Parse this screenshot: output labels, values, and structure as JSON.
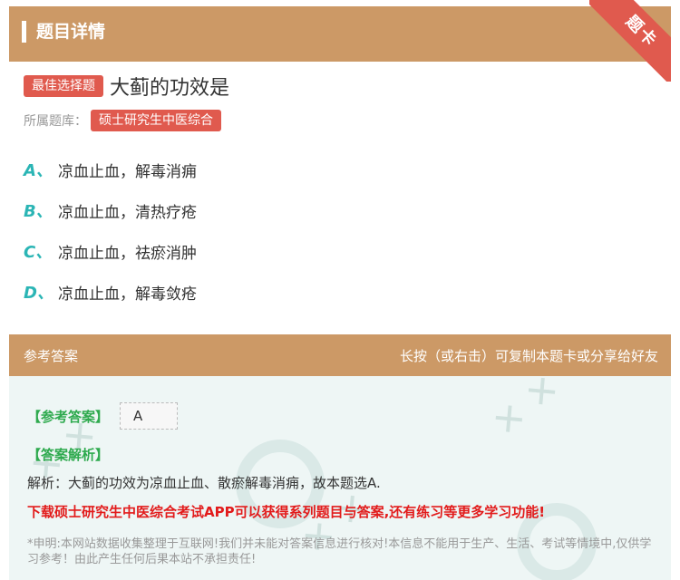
{
  "header": {
    "title": "题目详情",
    "ribbon_label": "题卡"
  },
  "question": {
    "type_badge": "最佳选择题",
    "title": "大蓟的功效是",
    "library_label": "所属题库：",
    "library_name": "硕士研究生中医综合"
  },
  "options": [
    {
      "letter": "A、",
      "text": "凉血止血，解毒消痈"
    },
    {
      "letter": "B、",
      "text": "凉血止血，清热疗疮"
    },
    {
      "letter": "C、",
      "text": "凉血止血，祛瘀消肿"
    },
    {
      "letter": "D、",
      "text": "凉血止血，解毒敛疮"
    }
  ],
  "answer": {
    "section_label": "参考答案",
    "share_hint": "长按（或右击）可复制本题卡或分享给好友",
    "ref_label": "【参考答案】",
    "ref_value": "A",
    "explain_label": "【答案解析】",
    "explain_text": "解析：大蓟的功效为凉血止血、散瘀解毒消痈，故本题选A.",
    "promo_text": "下载硕士研究生中医综合考试APP可以获得系列题目与答案,还有练习等更多学习功能!",
    "disclaimer": "*申明:本网站数据收集整理于互联网!我们并未能对答案信息进行核对!本信息不能用于生产、生活、考试等情境中,仅供学习参考！由此产生任何后果本站不承担责任!"
  },
  "colors": {
    "header_bg": "#cc9966",
    "accent_red": "#e05a4e",
    "option_letter": "#2bb5b5",
    "answer_green": "#2eaa4e",
    "promo_red": "#e21b1b",
    "answer_bg": "#eef6f5"
  }
}
